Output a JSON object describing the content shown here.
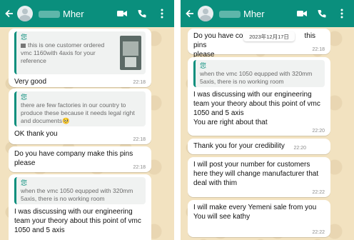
{
  "left": {
    "contact_name": "Mher",
    "messages": [
      {
        "quote_author": "您",
        "quote_text": "this is one customer ordered vmc 1160with 4axis for your reference",
        "text": "Very good",
        "time": "22:18"
      },
      {
        "quote_author": "您",
        "quote_text": "there are few factories in our country to produce these because it needs legal right and documents🥺",
        "text": "OK thank you",
        "time": "22:18"
      },
      {
        "text": "Do you have company make this pins please",
        "time": "22:18"
      },
      {
        "quote_author": "您",
        "quote_text": "when the vmc 1050 equpped with 320mm 5axis, there is no working room",
        "text": "I was discussing with our engineering team your theory about this point of vmc 1050 and 5 axis",
        "time": ""
      }
    ]
  },
  "right": {
    "contact_name": "Mher",
    "date_chip": "2023年12月17日",
    "messages": [
      {
        "text_a": "Do you have co",
        "text_b": "this pins",
        "text_c": "please",
        "time": "22:18"
      },
      {
        "quote_author": "您",
        "quote_text": "when the vmc 1050 equpped with 320mm 5axis, there is no working room",
        "text": "I was discussing with our engineering team your theory about this point of vmc 1050 and 5 axis\nYou are right about that",
        "time": "22:20"
      },
      {
        "text": "Thank you for your credibility",
        "time": "22:20"
      },
      {
        "text": "I will post your number for customers here they will change manufacturer that deal with thim",
        "time": "22:22"
      },
      {
        "text": "I will make every Yemeni sale from you\nYou will see kathy",
        "time": "22:22"
      }
    ]
  }
}
